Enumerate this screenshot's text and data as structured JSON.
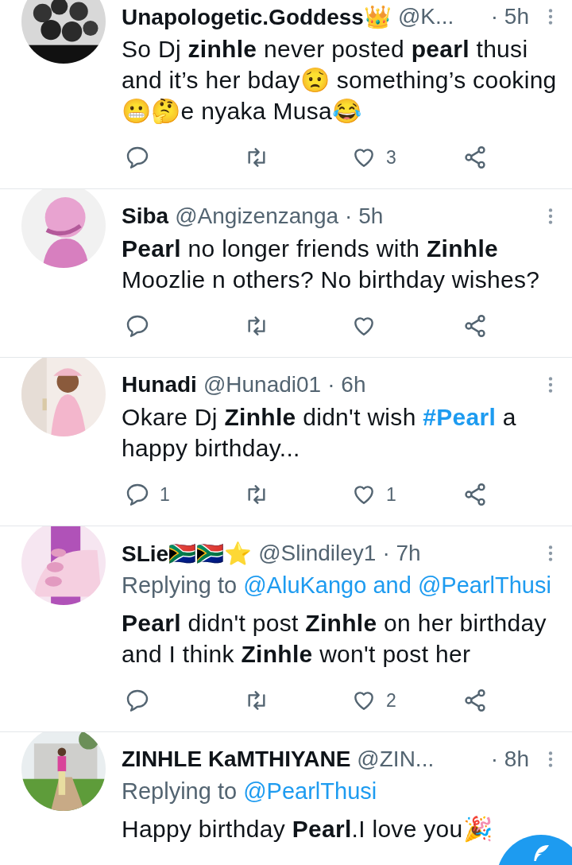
{
  "tweets": [
    {
      "name": "Unapologetic.Goddess👑",
      "handle": "@K...",
      "time": "· 5h",
      "avatar": {
        "kind": "picture"
      },
      "text": "So Dj **zinhle** never posted **pearl** thusi and it’s her bday😟 something’s cooking 😬🤔e nyaka Musa😂",
      "actions": [
        {
          "kind": "reply"
        },
        {
          "kind": "retweet"
        },
        {
          "kind": "like",
          "count": "3"
        },
        {
          "kind": "share"
        }
      ]
    },
    {
      "name": "Siba",
      "handle": "@Angizenzanga",
      "time": "· 5h",
      "avatar": {
        "kind": "picture"
      },
      "text": "**Pearl** no longer friends with **Zinhle** Moozlie n others? No birthday wishes?",
      "actions": [
        {
          "kind": "reply"
        },
        {
          "kind": "retweet"
        },
        {
          "kind": "like"
        },
        {
          "kind": "share"
        }
      ]
    },
    {
      "name": "Hunadi",
      "handle": "@Hunadi01",
      "time": "· 6h",
      "avatar": {
        "kind": "picture"
      },
      "text": "Okare Dj **Zinhle** didn't wish ",
      "hashtag": "#Pearl",
      "text_after": " a happy birthday...",
      "actions": [
        {
          "kind": "reply",
          "count": "1"
        },
        {
          "kind": "retweet"
        },
        {
          "kind": "like",
          "count": "1"
        },
        {
          "kind": "share"
        }
      ]
    },
    {
      "name": "SLie🇿🇦🇿🇦⭐",
      "handle": "@Slindiley1",
      "time": "· 7h",
      "avatar": {
        "kind": "picture"
      },
      "replying": {
        "label": "Replying to",
        "mentions": [
          "@AluKango",
          "@PearlThusi"
        ],
        "joiner": "and"
      },
      "text": "**Pearl** didn't post **Zinhle** on her birthday and I think **Zinhle** won't post her",
      "actions": [
        {
          "kind": "reply"
        },
        {
          "kind": "retweet"
        },
        {
          "kind": "like",
          "count": "2"
        },
        {
          "kind": "share"
        }
      ]
    },
    {
      "name": "ZINHLE KaMTHIYANE",
      "handle": "@ZIN...",
      "time": "· 8h",
      "avatar": {
        "kind": "picture"
      },
      "replying": {
        "label": "Replying to",
        "mentions": [
          "@PearlThusi"
        ]
      },
      "text": "Happy birthday **Pearl**.I love you🎉"
    }
  ],
  "compose_button": {
    "kind": "fab"
  }
}
